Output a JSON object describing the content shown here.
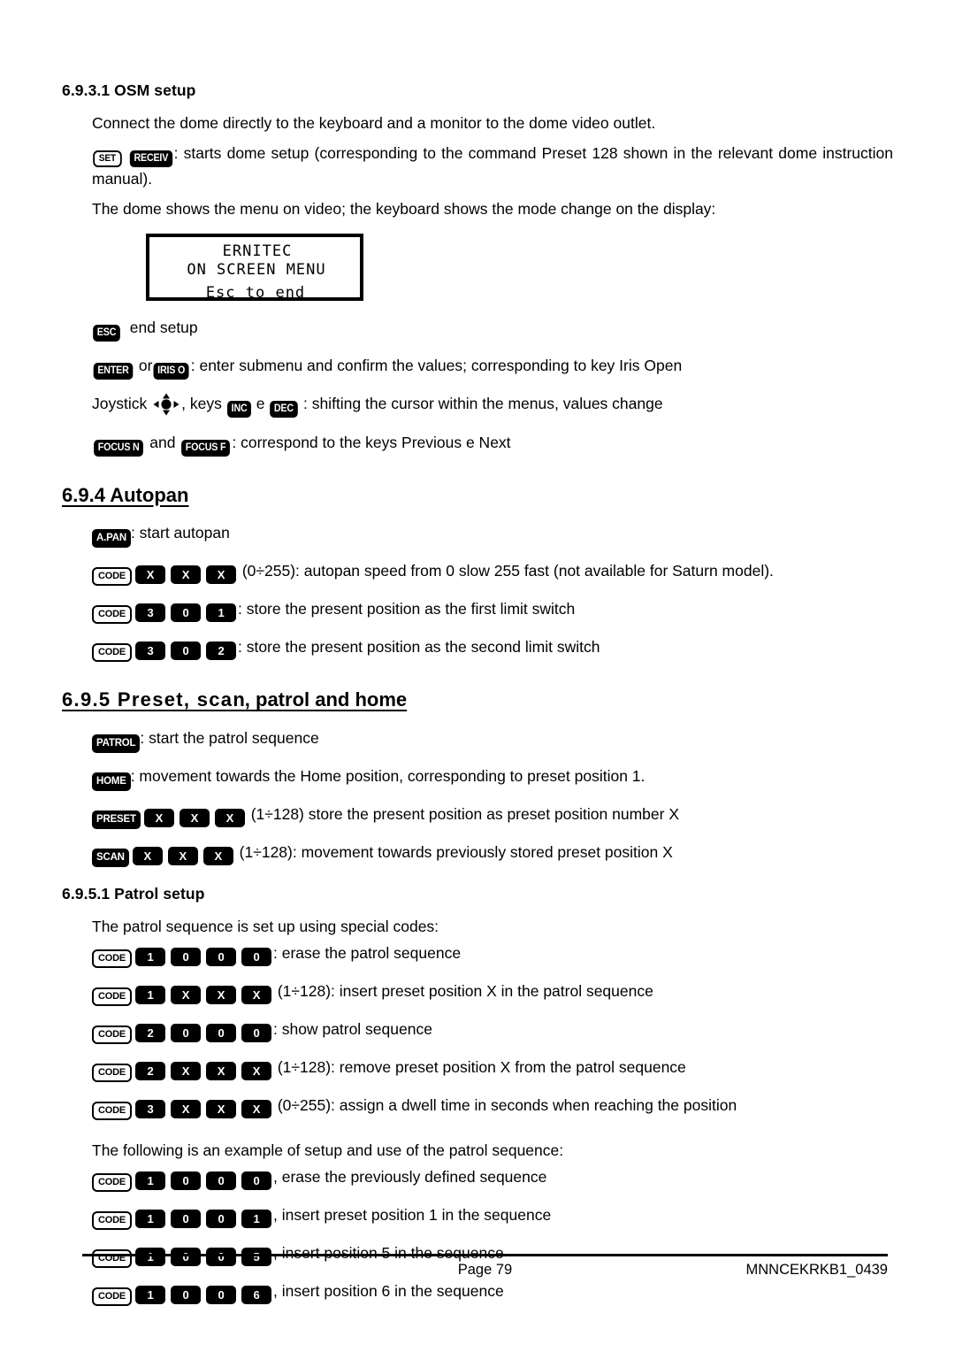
{
  "document": {
    "section_osm": {
      "heading": "6.9.3.1 OSM setup",
      "intro": "Connect the dome directly to the keyboard and a monitor to the dome video outlet.",
      "setup_keys": [
        "SET",
        "RECEIV"
      ],
      "setup_text": ": starts dome setup (corresponding to the command Preset 128 shown in the relevant dome instruction manual).",
      "menu_note": "The dome shows the menu on video; the keyboard shows the mode change on the display:"
    },
    "lcd": {
      "line1": "ERNITEC",
      "line2": "ON SCREEN MENU",
      "line3": "Esc to end"
    },
    "osm_keys": [
      {
        "keys": [
          "ESC"
        ],
        "text": "end setup"
      },
      {
        "keys": [
          "ENTER",
          "IRIS O"
        ],
        "joiner": "or",
        "text": ": enter submenu and confirm the values; corresponding to key Iris Open"
      },
      {
        "prefix": "Joystick",
        "icon": "joystick-icon",
        "mid": ", keys",
        "keys": [
          "INC",
          "DEC"
        ],
        "joiner": "e",
        "text": ": shifting the cursor within the menus, values change"
      },
      {
        "keys": [
          "FOCUS N",
          "FOCUS F"
        ],
        "joiner": "and",
        "text": ": correspond to the keys Previous e Next"
      }
    ],
    "section_autopan": {
      "heading": "6.9.4 Autopan",
      "rows": [
        {
          "label_key": "A.PAN",
          "label_style": "black",
          "digits": [],
          "text": ": start autopan"
        },
        {
          "label_key": "CODE",
          "label_style": "white",
          "digits": [
            "X",
            "X",
            "X"
          ],
          "text": "(0÷255): autopan speed from 0 slow 255 fast (not available for Saturn model)."
        },
        {
          "label_key": "CODE",
          "label_style": "white",
          "digits": [
            "3",
            "0",
            "1"
          ],
          "text": ": store the present position as the first limit switch"
        },
        {
          "label_key": "CODE",
          "label_style": "white",
          "digits": [
            "3",
            "0",
            "2"
          ],
          "text": ": store the present position as the second limit switch"
        }
      ]
    },
    "section_preset": {
      "heading_part1": "6.9.5 Preset, sca",
      "heading_part2": "n, patrol and home",
      "heading_full": "6.9.5 Preset, scan, patrol and home",
      "rows": [
        {
          "label_key": "PATROL",
          "label_style": "black",
          "digits": [],
          "text": ": start the patrol sequence"
        },
        {
          "label_key": "HOME",
          "label_style": "black",
          "digits": [],
          "text": ": movement towards the Home position, corresponding to preset position 1."
        },
        {
          "label_key": "PRESET",
          "label_style": "black",
          "digits": [
            "X",
            "X",
            "X"
          ],
          "text": "(1÷128) store the present position as preset position number X"
        },
        {
          "label_key": "SCAN",
          "label_style": "black",
          "digits": [
            "X",
            "X",
            "X"
          ],
          "text": "(1÷128): movement towards previously stored preset position X"
        }
      ]
    },
    "section_patrol_setup": {
      "heading": "6.9.5.1 Patrol setup",
      "intro": "The patrol sequence is set up using special codes:",
      "rows": [
        {
          "label_key": "CODE",
          "label_style": "white",
          "digits": [
            "1",
            "0",
            "0",
            "0"
          ],
          "text": ": erase the patrol sequence"
        },
        {
          "label_key": "CODE",
          "label_style": "white",
          "digits": [
            "1",
            "X",
            "X",
            "X"
          ],
          "text": "(1÷128): insert preset position X in the patrol sequence"
        },
        {
          "label_key": "CODE",
          "label_style": "white",
          "digits": [
            "2",
            "0",
            "0",
            "0"
          ],
          "text": ": show patrol sequence"
        },
        {
          "label_key": "CODE",
          "label_style": "white",
          "digits": [
            "2",
            "X",
            "X",
            "X"
          ],
          "text": "(1÷128): remove preset position X from the patrol sequence"
        },
        {
          "label_key": "CODE",
          "label_style": "white",
          "digits": [
            "3",
            "X",
            "X",
            "X"
          ],
          "text": "(0÷255): assign a dwell time in seconds when reaching the position"
        }
      ],
      "example_intro": "The following is an example of setup and use of the patrol sequence:",
      "example_rows": [
        {
          "label_key": "CODE",
          "label_style": "white",
          "digits": [
            "1",
            "0",
            "0",
            "0"
          ],
          "text": ", erase the previously defined sequence"
        },
        {
          "label_key": "CODE",
          "label_style": "white",
          "digits": [
            "1",
            "0",
            "0",
            "1"
          ],
          "text": ", insert preset position 1 in the sequence"
        },
        {
          "label_key": "CODE",
          "label_style": "white",
          "digits": [
            "1",
            "0",
            "0",
            "5"
          ],
          "text": ", insert position 5 in the sequence"
        },
        {
          "label_key": "CODE",
          "label_style": "white",
          "digits": [
            "1",
            "0",
            "0",
            "6"
          ],
          "text": ", insert position 6 in the sequence"
        }
      ]
    },
    "footer": {
      "page": "Page 79",
      "doc_id": "MNNCEKRKB1_0439"
    }
  }
}
